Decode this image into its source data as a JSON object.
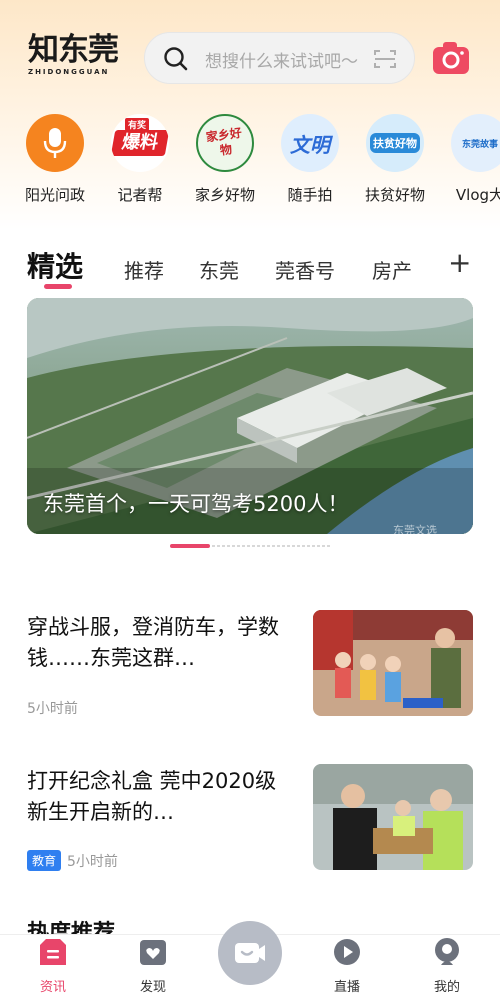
{
  "header": {
    "logo_main": "知东莞",
    "logo_sub": "ZHIDONGGUAN",
    "search_placeholder": "想搜什么来试试吧～",
    "icons": [
      "search-icon",
      "scan-icon",
      "camera-icon"
    ]
  },
  "shortcuts": [
    {
      "label": "阳光问政",
      "icon": "microphone-icon",
      "color": "#f5841f"
    },
    {
      "label": "记者帮",
      "icon": "baoliao-icon",
      "badge": "有奖",
      "text": "爆料",
      "color": "#e0252b"
    },
    {
      "label": "家乡好物",
      "icon": "jiaxiang-icon",
      "text": "家乡好物",
      "color": "#2e8a3e"
    },
    {
      "label": "随手拍",
      "icon": "wenming-icon",
      "text": "文明",
      "color": "#2d6bd6"
    },
    {
      "label": "扶贫好物",
      "icon": "fupin-icon",
      "text": "扶贫好物",
      "color": "#2a8ad8"
    },
    {
      "label": "Vlog大",
      "icon": "vlog-icon",
      "text": "东莞故事",
      "color": "#1f6ec9"
    }
  ],
  "tabs": {
    "items": [
      "精选",
      "推荐",
      "东莞",
      "莞香号",
      "房产"
    ],
    "active": "精选",
    "more": "+"
  },
  "banner": {
    "caption": "东莞首个，一天可驾考5200人！",
    "watermark": "东莞文选"
  },
  "news": [
    {
      "title": "穿战斗服，登消防车，学数钱……东莞这群…",
      "tag": "",
      "time": "5小时前"
    },
    {
      "title": "打开纪念礼盒 莞中2020级新生开启新的…",
      "tag": "教育",
      "time": "5小时前"
    }
  ],
  "section_peek": "热度推荐",
  "bottom_nav": [
    {
      "label": "资讯",
      "icon": "news-icon",
      "active": true
    },
    {
      "label": "发现",
      "icon": "discover-icon",
      "active": false
    },
    {
      "label": "",
      "icon": "video-icon",
      "active": false
    },
    {
      "label": "直播",
      "icon": "live-icon",
      "active": false
    },
    {
      "label": "我的",
      "icon": "profile-icon",
      "active": false
    }
  ],
  "colors": {
    "accent": "#e8456a",
    "tag_blue": "#2f7ff0"
  }
}
